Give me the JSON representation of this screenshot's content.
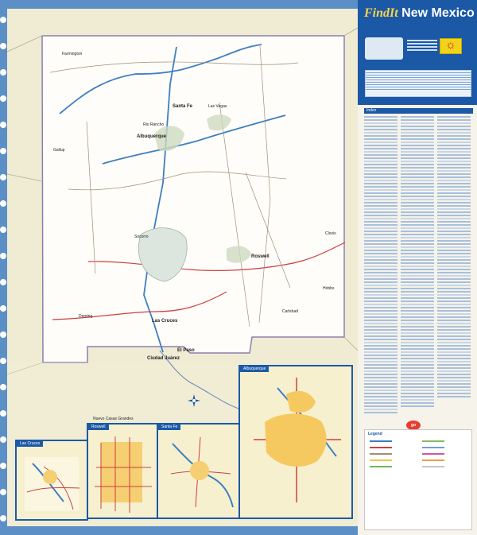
{
  "header": {
    "findit": "FindIt",
    "state": "New Mexico"
  },
  "panel": {
    "index_title": "Index",
    "legend_title": "Legend",
    "logo_text": "go"
  },
  "map": {
    "cities": [
      {
        "name": "Albuquerque"
      },
      {
        "name": "Santa Fe"
      },
      {
        "name": "Las Cruces"
      },
      {
        "name": "El Paso"
      },
      {
        "name": "Ciudad Juárez"
      },
      {
        "name": "Roswell"
      },
      {
        "name": "Gallup"
      },
      {
        "name": "Farmington"
      },
      {
        "name": "Clovis"
      },
      {
        "name": "Carlsbad"
      },
      {
        "name": "Hobbs"
      },
      {
        "name": "Rio Rancho"
      },
      {
        "name": "Las Vegas"
      },
      {
        "name": "Socorro"
      },
      {
        "name": "Deming"
      }
    ],
    "insets": [
      {
        "name": "Las Cruces"
      },
      {
        "name": "Roswell"
      },
      {
        "name": "Santa Fe"
      },
      {
        "name": "Albuquerque"
      }
    ]
  },
  "map_labels": {
    "nuevo": "Nuevo Casas Grandes",
    "juarez": "Ciudad Juárez"
  }
}
